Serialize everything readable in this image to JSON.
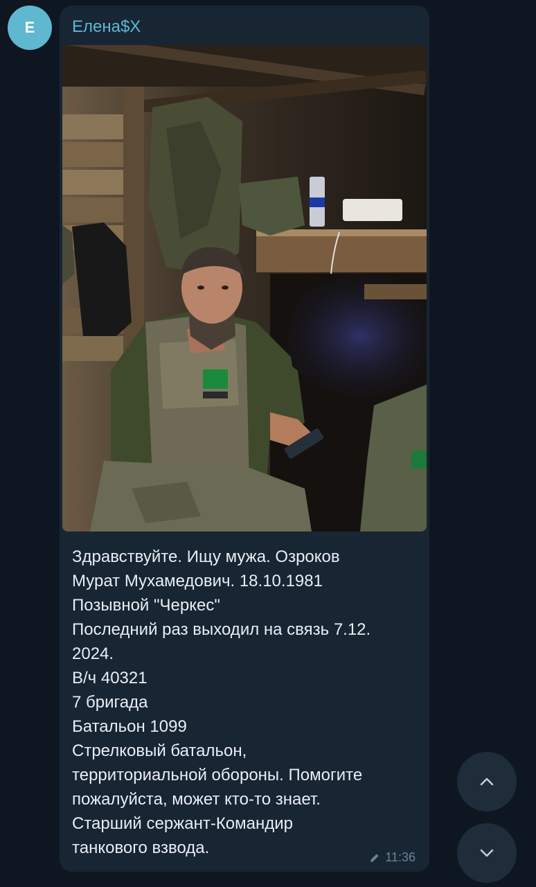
{
  "sender": {
    "avatar_letter": "E",
    "name": "Елена$X",
    "name_color": "#5fb8d0",
    "avatar_color": "#5fb8d0"
  },
  "message": {
    "photo_icon": "photo",
    "lines": [
      "Здравствуйте. Ищу мужа. Озроков",
      "Мурат Мухамедович. 18.10.1981",
      "Позывной \"Черкес\"",
      "Последний раз выходил на связь 7.12.",
      "2024.",
      "В/ч 40321",
      "7 бригада",
      "Батальон 1099",
      "Стрелковый батальон,",
      "территориальной обороны. Помогите",
      "пожалуйста, может кто-то знает.",
      "Старший сержант-Командир",
      "танкового взвода."
    ],
    "time": "11:36",
    "edited_icon": "pencil-icon"
  },
  "navigation": {
    "up_icon": "chevron-up-icon",
    "down_icon": "chevron-down-icon"
  },
  "colors": {
    "background": "#0e1621",
    "bubble": "#182533",
    "text": "#e8eef4",
    "meta": "#6d8296"
  }
}
